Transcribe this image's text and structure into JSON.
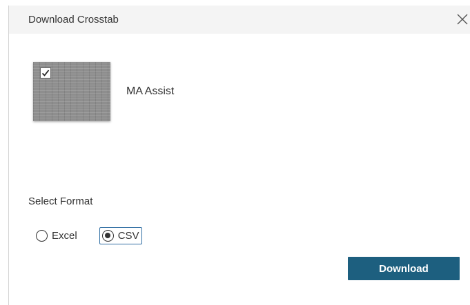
{
  "dialog": {
    "title": "Download Crosstab",
    "close_icon": "close-icon"
  },
  "sheets": [
    {
      "name": "MA Assist",
      "selected": true
    }
  ],
  "format": {
    "label": "Select Format",
    "options": [
      {
        "label": "Excel",
        "selected": false
      },
      {
        "label": "CSV",
        "selected": true
      }
    ]
  },
  "actions": {
    "download_label": "Download"
  },
  "colors": {
    "header_bg": "#f4f4f4",
    "button_bg": "#1d5f7f",
    "focus_outline": "#2d6ca2",
    "text": "#333333"
  }
}
